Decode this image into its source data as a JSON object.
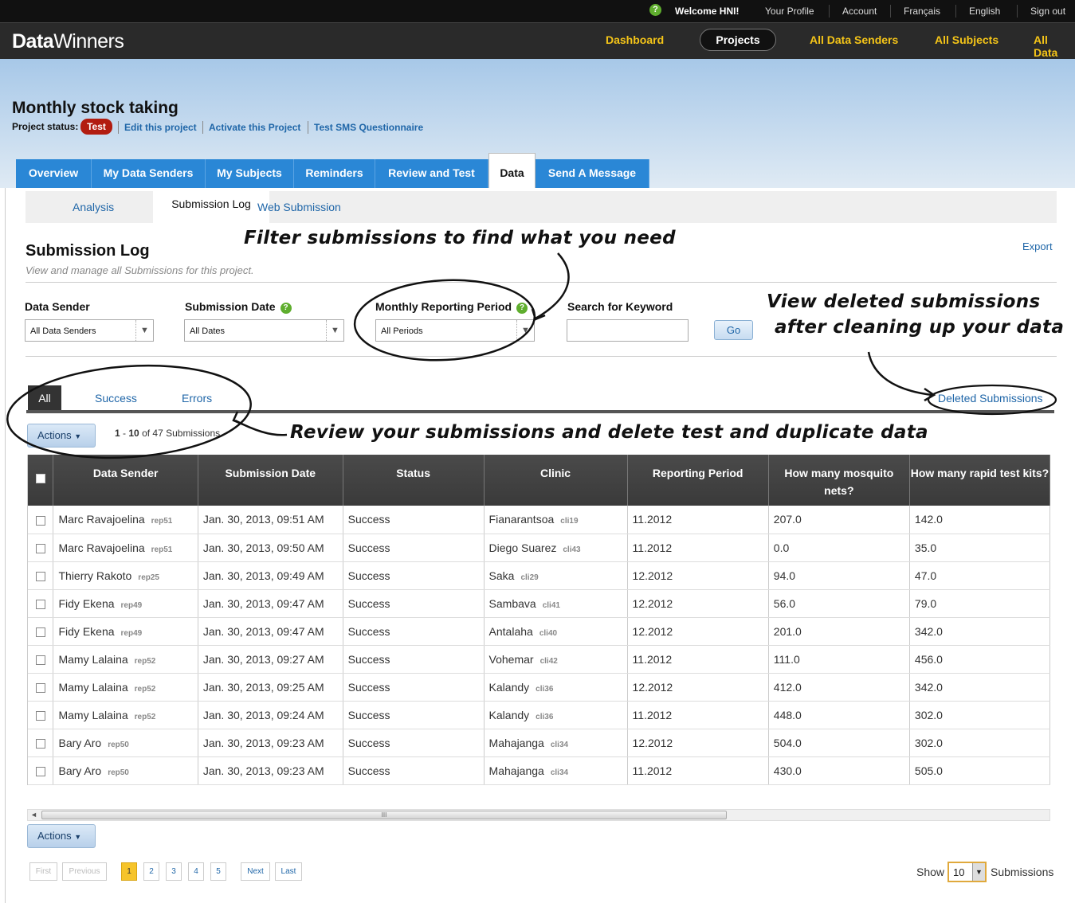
{
  "topbar": {
    "welcome": "Welcome HNI!",
    "links": [
      "Your Profile",
      "Account",
      "Français",
      "English",
      "Sign out"
    ]
  },
  "header": {
    "logo_bold": "Data",
    "logo_light": "Winners",
    "nav": [
      "Dashboard",
      "Projects",
      "All Data Senders",
      "All Subjects",
      "All Data"
    ]
  },
  "project": {
    "title": "Monthly stock taking",
    "status_label": "Project status:",
    "status": "Test",
    "links": [
      "Edit this project",
      "Activate this Project",
      "Test SMS Questionnaire"
    ]
  },
  "tabs": [
    "Overview",
    "My Data Senders",
    "My Subjects",
    "Reminders",
    "Review and Test",
    "Data",
    "Send A Message"
  ],
  "subtabs": [
    "Analysis",
    "Submission Log",
    "Web Submission"
  ],
  "submission_log": {
    "title": "Submission Log",
    "subtitle": "View and manage all Submissions for this project.",
    "export": "Export"
  },
  "filters": {
    "data_sender_label": "Data Sender",
    "data_sender_value": "All Data Senders",
    "submission_date_label": "Submission Date",
    "submission_date_value": "All Dates",
    "period_label": "Monthly Reporting Period",
    "period_value": "All Periods",
    "keyword_label": "Search for Keyword",
    "keyword_value": "",
    "go": "Go"
  },
  "filter_tabs": [
    "All",
    "Success",
    "Errors"
  ],
  "deleted_link": "Deleted Submissions",
  "actions_label": "Actions",
  "count": {
    "range_start": "1",
    "range_end": "10",
    "of": "of 47 Submissions"
  },
  "table": {
    "columns": [
      "Data Sender",
      "Submission Date",
      "Status",
      "Clinic",
      "Reporting Period",
      "How many mosquito nets?",
      "How many rapid test kits?"
    ],
    "rows": [
      {
        "sender": "Marc Ravajoelina",
        "sender_code": "rep51",
        "date": "Jan. 30, 2013, 09:51 AM",
        "status": "Success",
        "clinic": "Fianarantsoa",
        "clinic_code": "cli19",
        "period": "11.2012",
        "nets": "207.0",
        "kits": "142.0"
      },
      {
        "sender": "Marc Ravajoelina",
        "sender_code": "rep51",
        "date": "Jan. 30, 2013, 09:50 AM",
        "status": "Success",
        "clinic": "Diego Suarez",
        "clinic_code": "cli43",
        "period": "11.2012",
        "nets": "0.0",
        "kits": "35.0"
      },
      {
        "sender": "Thierry Rakoto",
        "sender_code": "rep25",
        "date": "Jan. 30, 2013, 09:49 AM",
        "status": "Success",
        "clinic": "Saka",
        "clinic_code": "cli29",
        "period": "12.2012",
        "nets": "94.0",
        "kits": "47.0"
      },
      {
        "sender": "Fidy Ekena",
        "sender_code": "rep49",
        "date": "Jan. 30, 2013, 09:47 AM",
        "status": "Success",
        "clinic": "Sambava",
        "clinic_code": "cli41",
        "period": "12.2012",
        "nets": "56.0",
        "kits": "79.0"
      },
      {
        "sender": "Fidy Ekena",
        "sender_code": "rep49",
        "date": "Jan. 30, 2013, 09:47 AM",
        "status": "Success",
        "clinic": "Antalaha",
        "clinic_code": "cli40",
        "period": "12.2012",
        "nets": "201.0",
        "kits": "342.0"
      },
      {
        "sender": "Mamy Lalaina",
        "sender_code": "rep52",
        "date": "Jan. 30, 2013, 09:27 AM",
        "status": "Success",
        "clinic": "Vohemar",
        "clinic_code": "cli42",
        "period": "11.2012",
        "nets": "111.0",
        "kits": "456.0"
      },
      {
        "sender": "Mamy Lalaina",
        "sender_code": "rep52",
        "date": "Jan. 30, 2013, 09:25 AM",
        "status": "Success",
        "clinic": "Kalandy",
        "clinic_code": "cli36",
        "period": "12.2012",
        "nets": "412.0",
        "kits": "342.0"
      },
      {
        "sender": "Mamy Lalaina",
        "sender_code": "rep52",
        "date": "Jan. 30, 2013, 09:24 AM",
        "status": "Success",
        "clinic": "Kalandy",
        "clinic_code": "cli36",
        "period": "11.2012",
        "nets": "448.0",
        "kits": "302.0"
      },
      {
        "sender": "Bary Aro",
        "sender_code": "rep50",
        "date": "Jan. 30, 2013, 09:23 AM",
        "status": "Success",
        "clinic": "Mahajanga",
        "clinic_code": "cli34",
        "period": "12.2012",
        "nets": "504.0",
        "kits": "302.0"
      },
      {
        "sender": "Bary Aro",
        "sender_code": "rep50",
        "date": "Jan. 30, 2013, 09:23 AM",
        "status": "Success",
        "clinic": "Mahajanga",
        "clinic_code": "cli34",
        "period": "11.2012",
        "nets": "430.0",
        "kits": "505.0"
      }
    ]
  },
  "scrollbar_grip": "III",
  "pagination": {
    "first": "First",
    "previous": "Previous",
    "pages": [
      "1",
      "2",
      "3",
      "4",
      "5"
    ],
    "next": "Next",
    "last": "Last",
    "current_page": "1"
  },
  "page_size": {
    "show": "Show",
    "value": "10",
    "suffix": "Submissions"
  },
  "annotations": {
    "filter": "Filter submissions to find what you need",
    "deleted_line1": "View deleted submissions",
    "deleted_line2": "after cleaning up your data",
    "review": "Review your submissions and delete test and duplicate data"
  },
  "colors": {
    "accent_blue": "#2a87d6",
    "status_red": "#b21c10",
    "nav_yellow": "#f5c518",
    "page_current": "#f6c42b"
  },
  "icons": {
    "help": "question-circle-icon",
    "dropdown": "triangle-down-icon",
    "checkbox": "checkbox-icon"
  }
}
